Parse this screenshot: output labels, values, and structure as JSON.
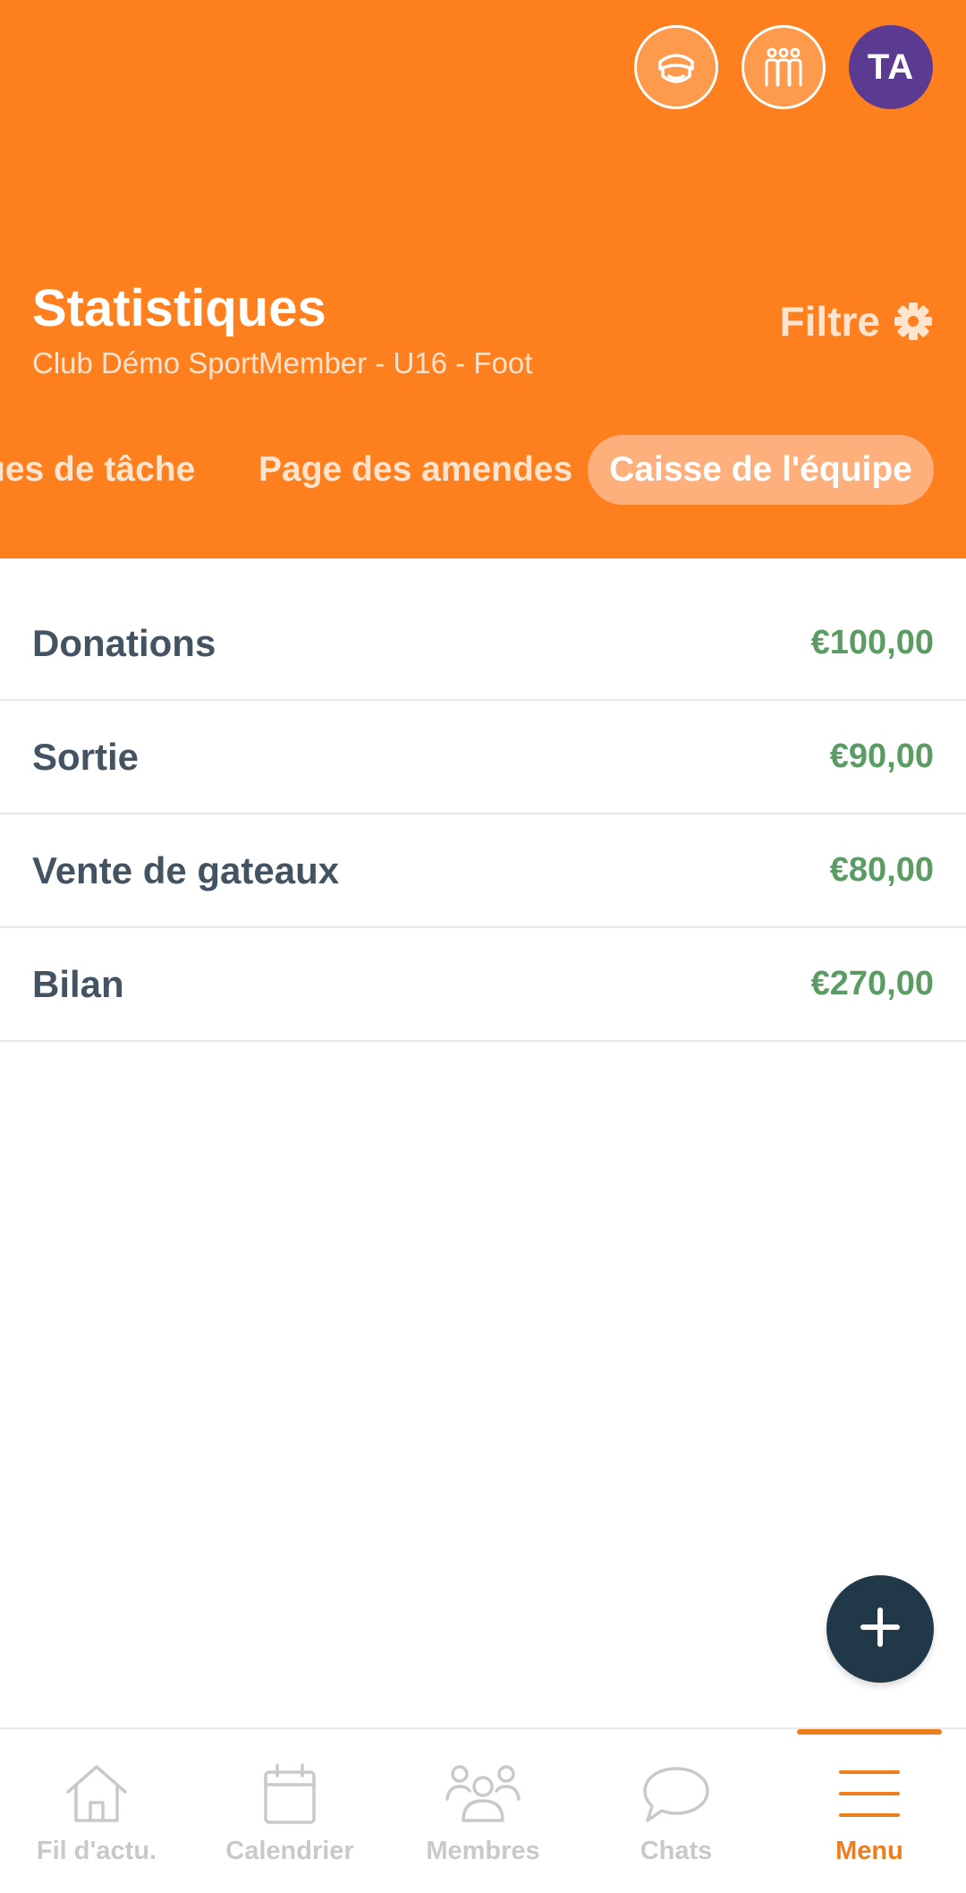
{
  "header": {
    "title": "Statistiques",
    "subtitle": "Club Démo SportMember - U16 - Foot",
    "filter_label": "Filtre",
    "avatar_initials": "TA",
    "accent_color": "#fd7f1d",
    "avatar_color": "#5b3a92"
  },
  "tabs": [
    {
      "label": "ues de tâche",
      "active": false
    },
    {
      "label": "Page des amendes",
      "active": false
    },
    {
      "label": "Caisse de l'équipe",
      "active": true
    }
  ],
  "rows": [
    {
      "label": "Donations",
      "value": "€100,00"
    },
    {
      "label": "Sortie",
      "value": "€90,00"
    },
    {
      "label": "Vente de gateaux",
      "value": "€80,00"
    },
    {
      "label": "Bilan",
      "value": "€270,00"
    }
  ],
  "value_color": "#5a9c63",
  "fab": {
    "icon": "plus-icon"
  },
  "nav": [
    {
      "label": "Fil d'actu.",
      "icon": "home-icon",
      "active": false
    },
    {
      "label": "Calendrier",
      "icon": "calendar-icon",
      "active": false
    },
    {
      "label": "Membres",
      "icon": "members-icon",
      "active": false
    },
    {
      "label": "Chats",
      "icon": "chat-icon",
      "active": false
    },
    {
      "label": "Menu",
      "icon": "menu-icon",
      "active": true
    }
  ]
}
